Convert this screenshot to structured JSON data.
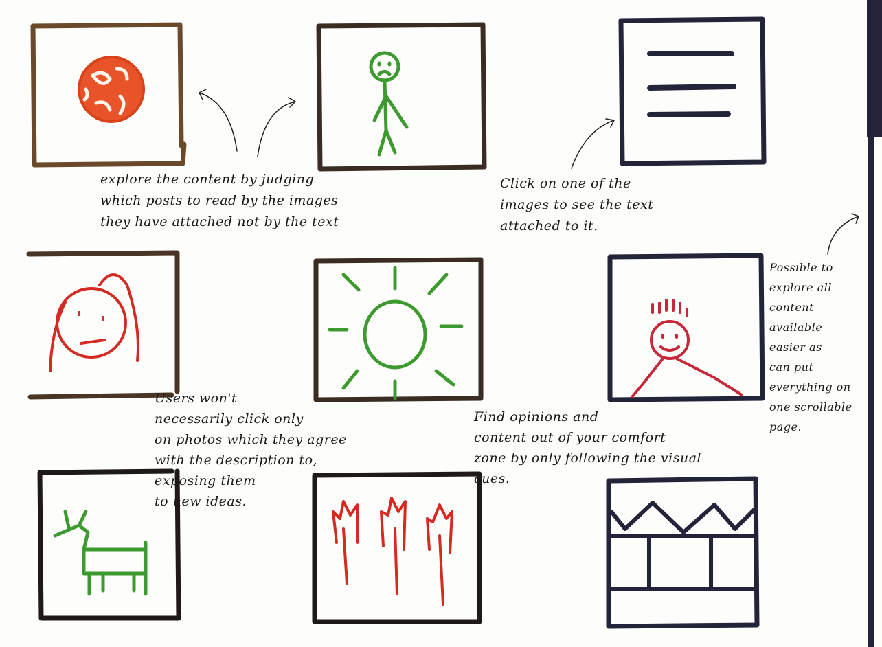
{
  "tiles": [
    {
      "icon": "ball-icon",
      "frame_color": "#6b4a2a",
      "drawing_color": "#e8532a"
    },
    {
      "icon": "stick-figure-icon",
      "frame_color": "#3a2c22",
      "drawing_color": "#3c9a2e"
    },
    {
      "icon": "text-lines-icon",
      "frame_color": "#23243a",
      "drawing_color": "#23243a"
    },
    {
      "icon": "girl-face-icon",
      "frame_color": "#4a3424",
      "drawing_color": "#d42a22"
    },
    {
      "icon": "sun-icon",
      "frame_color": "#3a2c22",
      "drawing_color": "#3c9a2e"
    },
    {
      "icon": "spiky-hair-person-icon",
      "frame_color": "#23243a",
      "drawing_color": "#c8283a"
    },
    {
      "icon": "dog-icon",
      "frame_color": "#1e1a18",
      "drawing_color": "#3c9a2e"
    },
    {
      "icon": "trees-icon",
      "frame_color": "#1e1a18",
      "drawing_color": "#d42a22"
    },
    {
      "icon": "building-icon",
      "frame_color": "#23243a",
      "drawing_color": "#23243a"
    }
  ],
  "notes": {
    "judging": "explore the content by judging\nwhich posts to read by the images\nthey have attached not by the text",
    "click": "Click on one of the\nimages to see the text\nattached to it.",
    "users": "Users won't\nnecessarily click only\non photos which they agree\nwith the description to,\nexposing them\nto new ideas.",
    "comfort": "Find opinions and\ncontent out of your comfort\nzone by only following the visual\ncues.",
    "scroll": "Possible to\nexplore all\ncontent\navailable\neasier as\ncan put\neverything on\none scrollable\npage."
  },
  "scrollbar": {
    "color": "#23243a"
  }
}
